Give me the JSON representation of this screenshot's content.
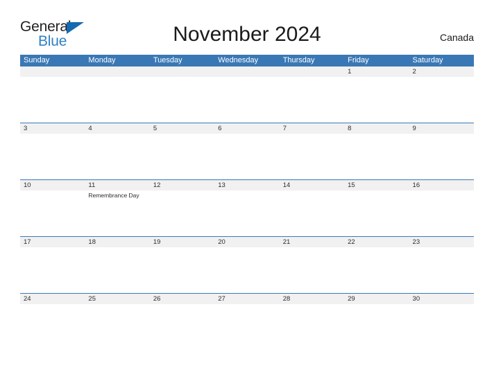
{
  "brand": {
    "name_part1": "General",
    "name_part2": "Blue",
    "triangle_color": "#1569b0",
    "blue_text_color": "#2f80c4"
  },
  "header": {
    "title": "November 2024",
    "country": "Canada"
  },
  "theme": {
    "header_blue": "#3a78b5",
    "daynum_band": "#f1f1f1",
    "row_divider": "#3a78b5",
    "text": "#2b2b2b",
    "background": "#ffffff"
  },
  "calendar": {
    "month": "November",
    "year": "2024",
    "weekday_headers": [
      "Sunday",
      "Monday",
      "Tuesday",
      "Wednesday",
      "Thursday",
      "Friday",
      "Saturday"
    ],
    "weeks": [
      {
        "days": [
          {
            "date": "",
            "events": []
          },
          {
            "date": "",
            "events": []
          },
          {
            "date": "",
            "events": []
          },
          {
            "date": "",
            "events": []
          },
          {
            "date": "",
            "events": []
          },
          {
            "date": "1",
            "events": []
          },
          {
            "date": "2",
            "events": []
          }
        ]
      },
      {
        "days": [
          {
            "date": "3",
            "events": []
          },
          {
            "date": "4",
            "events": []
          },
          {
            "date": "5",
            "events": []
          },
          {
            "date": "6",
            "events": []
          },
          {
            "date": "7",
            "events": []
          },
          {
            "date": "8",
            "events": []
          },
          {
            "date": "9",
            "events": []
          }
        ]
      },
      {
        "days": [
          {
            "date": "10",
            "events": []
          },
          {
            "date": "11",
            "events": [
              "Remembrance Day"
            ]
          },
          {
            "date": "12",
            "events": []
          },
          {
            "date": "13",
            "events": []
          },
          {
            "date": "14",
            "events": []
          },
          {
            "date": "15",
            "events": []
          },
          {
            "date": "16",
            "events": []
          }
        ]
      },
      {
        "days": [
          {
            "date": "17",
            "events": []
          },
          {
            "date": "18",
            "events": []
          },
          {
            "date": "19",
            "events": []
          },
          {
            "date": "20",
            "events": []
          },
          {
            "date": "21",
            "events": []
          },
          {
            "date": "22",
            "events": []
          },
          {
            "date": "23",
            "events": []
          }
        ]
      },
      {
        "days": [
          {
            "date": "24",
            "events": []
          },
          {
            "date": "25",
            "events": []
          },
          {
            "date": "26",
            "events": []
          },
          {
            "date": "27",
            "events": []
          },
          {
            "date": "28",
            "events": []
          },
          {
            "date": "29",
            "events": []
          },
          {
            "date": "30",
            "events": []
          }
        ]
      }
    ]
  }
}
